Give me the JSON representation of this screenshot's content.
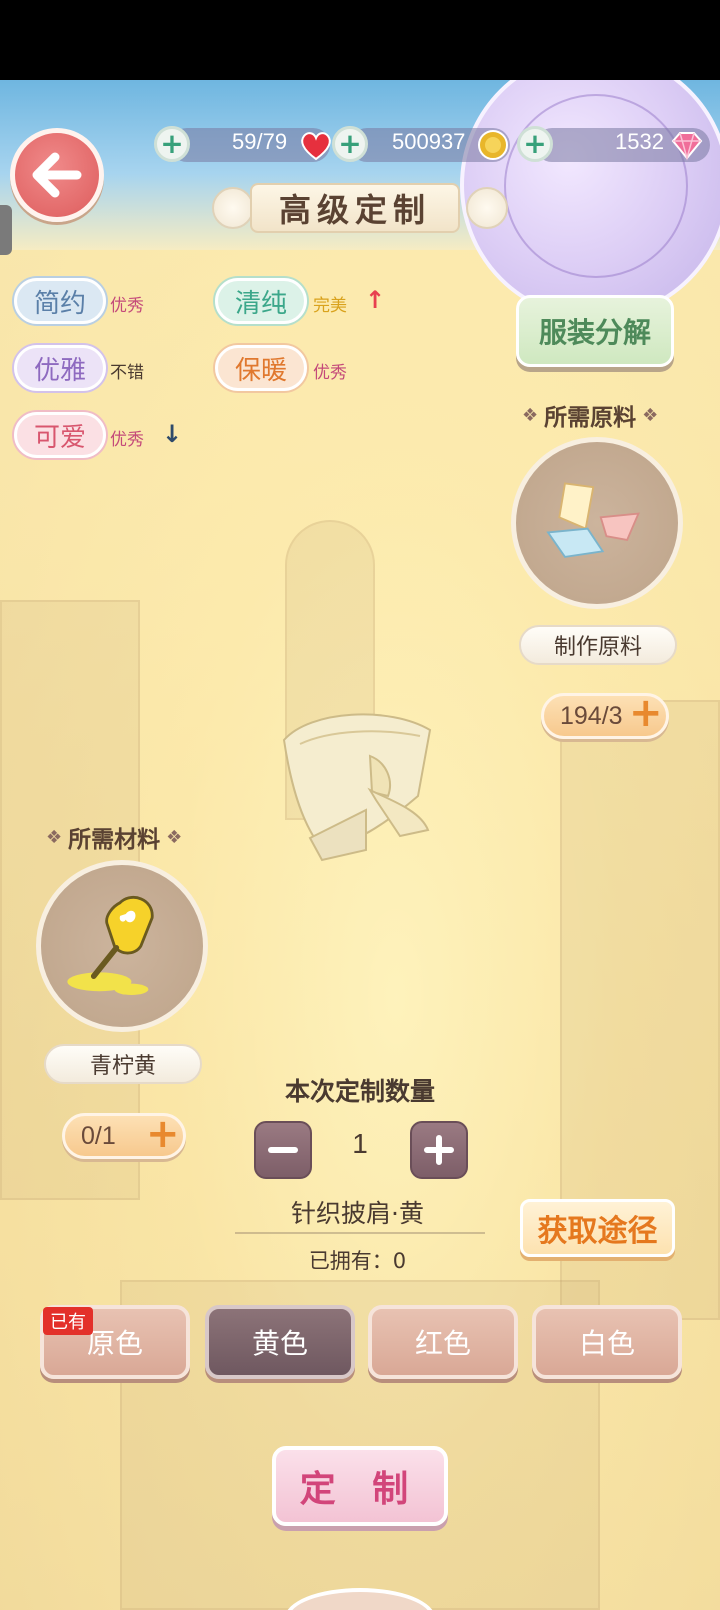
{
  "topbar": {
    "stamina": "59/79",
    "coins": "500937",
    "gems": "1532",
    "title": "高级定制"
  },
  "tags": [
    {
      "label": "简约",
      "rating": "优秀",
      "color": "#5a7fa8",
      "bg": "#dbe8f3"
    },
    {
      "label": "清纯",
      "rating": "完美",
      "color": "#3ba78a",
      "bg": "#dcf2e8"
    },
    {
      "label": "优雅",
      "rating": "不错",
      "color": "#8e6ac0",
      "bg": "#ece3f7"
    },
    {
      "label": "保暖",
      "rating": "优秀",
      "color": "#e0782e",
      "bg": "#fbe5d2"
    },
    {
      "label": "可爱",
      "rating": "优秀",
      "color": "#d8566e",
      "bg": "#fbe0e4"
    }
  ],
  "decompose_label": "服装分解",
  "raw_section": {
    "title": "所需原料",
    "name": "制作原料",
    "count": "194/3"
  },
  "material_section": {
    "title": "所需材料",
    "name": "青柠黄",
    "count": "0/1"
  },
  "quantity": {
    "label": "本次定制数量",
    "value": "1"
  },
  "item": {
    "name": "针织披肩·黄",
    "owned": "已拥有：0"
  },
  "acquire_label": "获取途径",
  "color_options": [
    {
      "label": "原色",
      "badge": "已有"
    },
    {
      "label": "黄色"
    },
    {
      "label": "红色"
    },
    {
      "label": "白色"
    }
  ],
  "customize_label": "定 制"
}
